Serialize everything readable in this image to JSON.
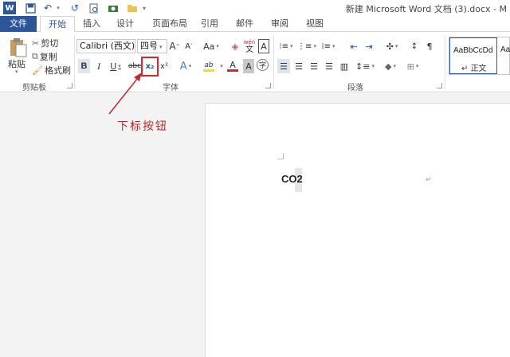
{
  "window": {
    "title": "新建 Microsoft Word 文档 (3).docx - M"
  },
  "tabs": [
    {
      "label": "文件"
    },
    {
      "label": "开始"
    },
    {
      "label": "插入"
    },
    {
      "label": "设计"
    },
    {
      "label": "页面布局"
    },
    {
      "label": "引用"
    },
    {
      "label": "邮件"
    },
    {
      "label": "审阅"
    },
    {
      "label": "视图"
    }
  ],
  "clipboard": {
    "paste_label": "粘贴",
    "cut_label": "剪切",
    "copy_label": "复制",
    "format_painter_label": "格式刷",
    "group_label": "剪贴板"
  },
  "font": {
    "font_name": "Calibri (西文)",
    "font_size": "四号",
    "group_label": "字体",
    "bold": "B",
    "italic": "I",
    "underline": "U",
    "strike": "abc",
    "subscript": "x₂",
    "superscript": "x²",
    "grow": "A",
    "shrink": "A",
    "change_case": "Aa",
    "phonetic_top": "wén",
    "phonetic_bottom": "文",
    "border_char": "A",
    "shade_char": "A",
    "enclose_char": "字",
    "text_effect": "A",
    "highlight": "ab",
    "font_color": "A",
    "colors": {
      "highlight": "#f5e400",
      "font_color": "#e02020"
    }
  },
  "paragraph": {
    "group_label": "段落"
  },
  "styles": {
    "preview_1": "AaBbCcDd",
    "preview_2": "Aa",
    "style_1_name": "正文"
  },
  "annotation": {
    "text": "下标按钮",
    "color": "#c0282d"
  },
  "document": {
    "text": "CO2",
    "para_mark": "↵"
  },
  "accent": "#2b579a"
}
